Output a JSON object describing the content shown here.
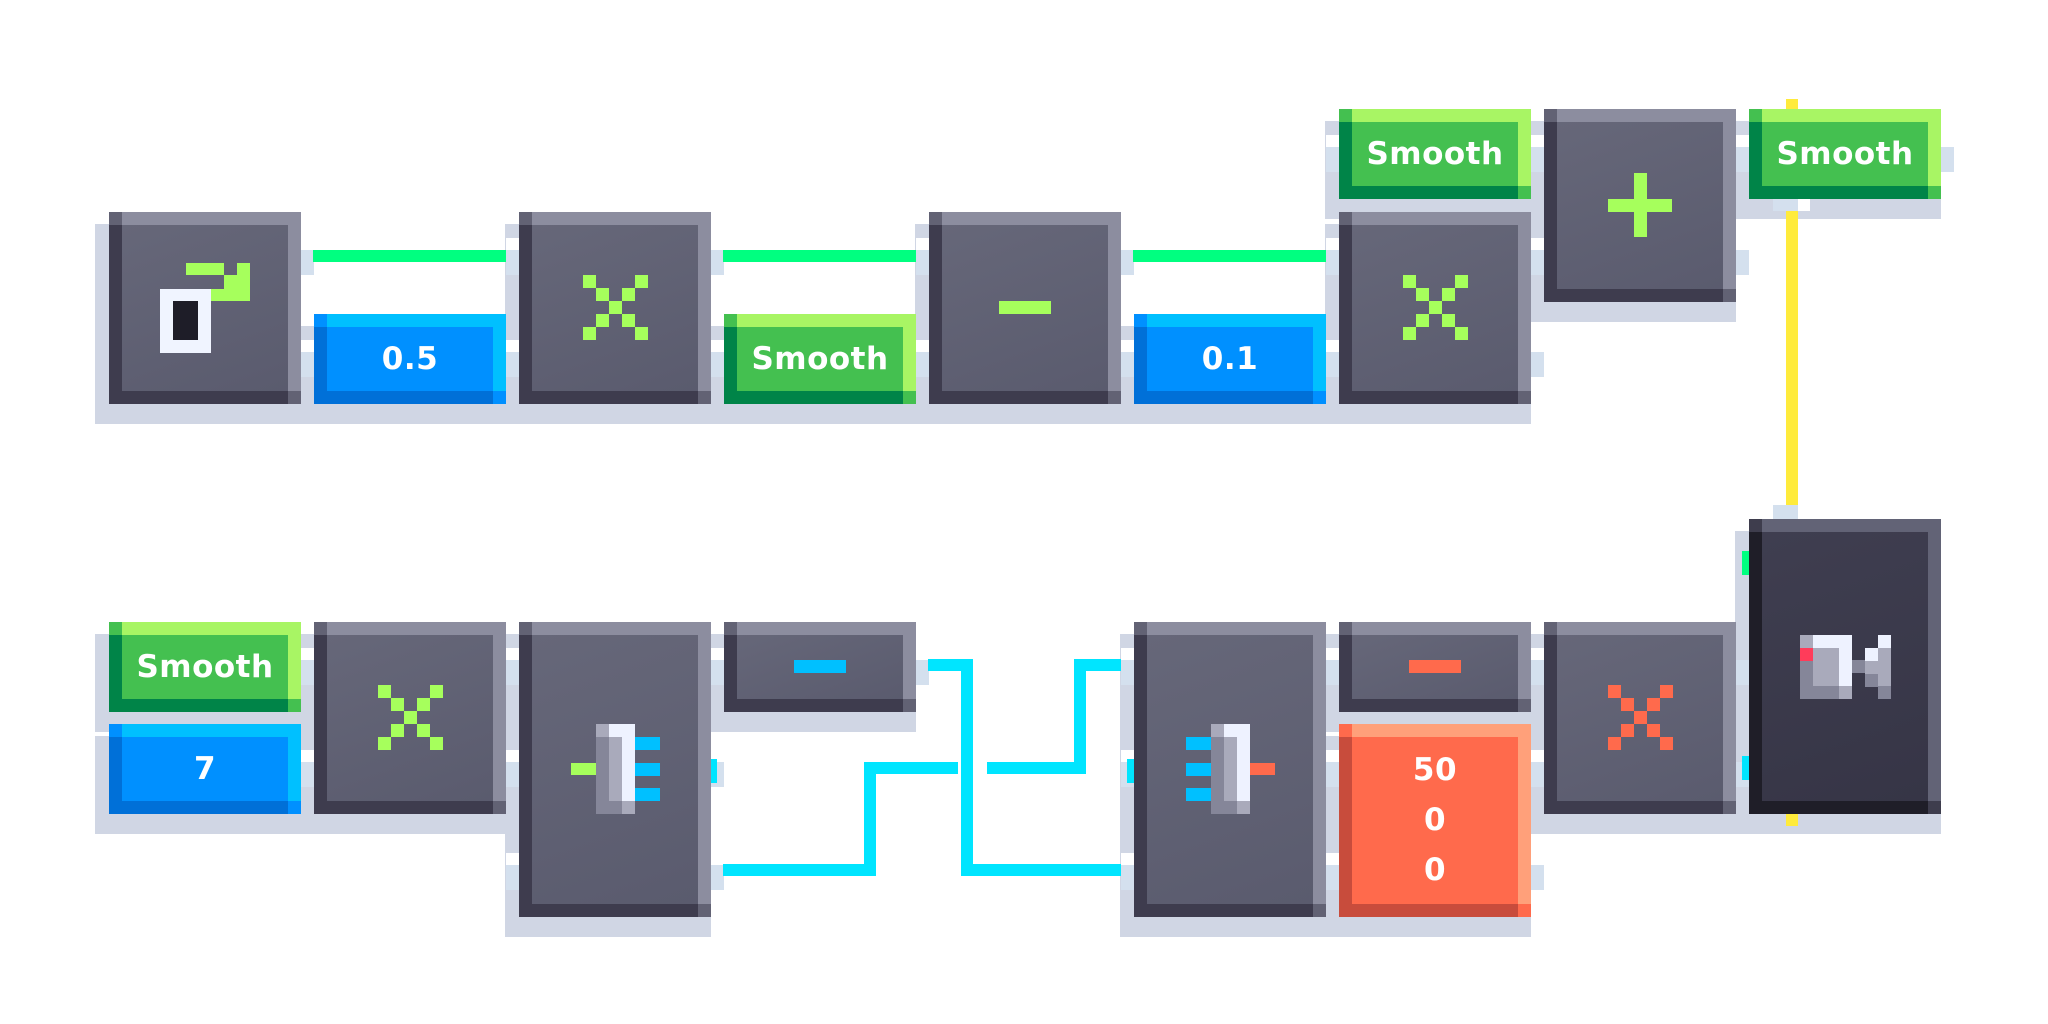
{
  "app": {
    "type": "node-graph-editor",
    "background": "#ffffff"
  },
  "palette": {
    "wire_green": "#00ff80",
    "wire_cyan": "#00e5ff",
    "wire_yellow": "#ffeb3b",
    "icon_green": "#a6ff5c",
    "icon_cyan": "#00c0ff",
    "icon_orange": "#ff6a4c",
    "port_light": "#d4e0ee",
    "port_white": "#ffffff",
    "camera_red": "#ff3c5a"
  },
  "nodes": [
    {
      "id": "n-input",
      "kind": "dark",
      "icon": "input-arrow-icon",
      "name": "input-node"
    },
    {
      "id": "n-val05",
      "kind": "blue",
      "label": "0.5",
      "name": "value-node-0-5"
    },
    {
      "id": "n-mul1",
      "kind": "dark",
      "icon": "multiply-icon",
      "icon_color": "green",
      "name": "multiply-node"
    },
    {
      "id": "n-smooth1",
      "kind": "green",
      "label": "Smooth",
      "name": "smooth-node"
    },
    {
      "id": "n-sub1",
      "kind": "dark",
      "icon": "minus-icon",
      "icon_color": "green",
      "name": "subtract-node"
    },
    {
      "id": "n-val01",
      "kind": "blue",
      "label": "0.1",
      "name": "value-node-0-1"
    },
    {
      "id": "n-mul2",
      "kind": "dark",
      "icon": "multiply-icon",
      "icon_color": "green",
      "name": "multiply-node"
    },
    {
      "id": "n-smooth2",
      "kind": "green",
      "label": "Smooth",
      "name": "smooth-node"
    },
    {
      "id": "n-add",
      "kind": "dark",
      "icon": "plus-icon",
      "icon_color": "green",
      "name": "add-node"
    },
    {
      "id": "n-smooth3",
      "kind": "green",
      "label": "Smooth",
      "name": "smooth-node"
    },
    {
      "id": "n-smooth4",
      "kind": "green",
      "label": "Smooth",
      "name": "smooth-node"
    },
    {
      "id": "n-val7",
      "kind": "blue",
      "label": "7",
      "name": "value-node-7"
    },
    {
      "id": "n-mul3",
      "kind": "dark",
      "icon": "multiply-icon",
      "icon_color": "green",
      "name": "multiply-node"
    },
    {
      "id": "n-split",
      "kind": "dark",
      "icon": "split-vector-icon",
      "name": "split-node"
    },
    {
      "id": "n-neg",
      "kind": "dark",
      "icon": "minus-icon",
      "icon_color": "cyan",
      "name": "negate-node"
    },
    {
      "id": "n-merge",
      "kind": "dark",
      "icon": "merge-vector-icon",
      "name": "merge-node"
    },
    {
      "id": "n-neg2",
      "kind": "dark",
      "icon": "minus-icon",
      "icon_color": "orange",
      "name": "negate-vector-node"
    },
    {
      "id": "n-vec",
      "kind": "orange",
      "values": [
        "50",
        "0",
        "0"
      ],
      "name": "vector-value-node"
    },
    {
      "id": "n-mul4",
      "kind": "dark",
      "icon": "multiply-icon",
      "icon_color": "orange",
      "name": "multiply-vector-node"
    },
    {
      "id": "n-camera",
      "kind": "cam",
      "icon": "camera-icon",
      "name": "camera-output-node"
    }
  ],
  "connections": [
    {
      "from": "n-input",
      "to": "n-mul1",
      "color": "wire_green"
    },
    {
      "from": "n-mul1",
      "to": "n-sub1",
      "color": "wire_green"
    },
    {
      "from": "n-sub1",
      "to": "n-mul2",
      "color": "wire_green"
    },
    {
      "from": "n-smooth3",
      "to": "n-camera",
      "color": "wire_yellow"
    },
    {
      "from": "n-neg",
      "to": "n-merge",
      "color": "wire_cyan"
    },
    {
      "from": "n-split",
      "to": "n-merge",
      "color": "wire_cyan"
    }
  ]
}
